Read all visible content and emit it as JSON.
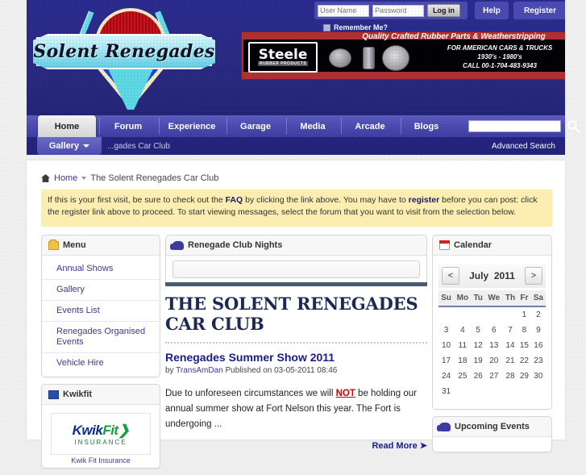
{
  "site": {
    "logo_text": "Solent Renegades"
  },
  "login": {
    "username_placeholder": "User Name",
    "password_placeholder": "Password",
    "login_label": "Log in",
    "remember_label": "Remember Me?",
    "help_label": "Help",
    "register_label": "Register"
  },
  "ad": {
    "headline": "Quality Crafted Rubber Parts & Weatherstripping",
    "brand": "Steele",
    "brand_sub": "RUBBER PRODUCTS",
    "line1": "FOR AMERICAN CARS & TRUCKS",
    "line2": "1930's - 1980's",
    "line3": "CALL 00-1-704-483-9343"
  },
  "nav": {
    "items": [
      {
        "label": "Home",
        "active": true
      },
      {
        "label": "Forum",
        "active": false
      },
      {
        "label": "Experience",
        "active": false
      },
      {
        "label": "Garage",
        "active": false
      },
      {
        "label": "Media",
        "active": false
      },
      {
        "label": "Arcade",
        "active": false
      },
      {
        "label": "Blogs",
        "active": false
      }
    ],
    "gallery_label": "Gallery",
    "subnav_text": "...gades Car Club",
    "advanced_search": "Advanced Search",
    "search_value": ""
  },
  "breadcrumb": {
    "home": "Home",
    "current": "The Solent Renegades Car Club"
  },
  "notice": {
    "part1": "If this is your first visit, be sure to check out the ",
    "faq": "FAQ",
    "part2": " by clicking the link above. You may have to ",
    "register": "register",
    "part3": " before you can post: click the register link above to proceed. To start viewing messages, select the forum that you want to visit from the selection below."
  },
  "sidebar": {
    "menu_title": "Menu",
    "menu_items": [
      {
        "label": "Annual Shows"
      },
      {
        "label": "Gallery"
      },
      {
        "label": "Events List"
      },
      {
        "label": "Renegades Organised Events"
      },
      {
        "label": "Vehicle Hire"
      }
    ],
    "kwikfit_title": "Kwikfit",
    "kwikfit_logo_a": "Kwik",
    "kwikfit_logo_b": "Fit",
    "kwikfit_logo_sub": "INSURANCE",
    "kwikfit_caption": "Kwik Fit Insurance"
  },
  "main": {
    "club_nights_title": "Renegade Club Nights",
    "page_title": "THE SOLENT RENEGADES CAR CLUB",
    "article": {
      "title": "Renegades Summer Show 2011",
      "by_label": "by",
      "author": "TransAmDan",
      "published_label": "Published on",
      "published_date": "03-05-2011 08:46",
      "body_pre": "Due to unforeseen circumstances we will ",
      "body_emphasis": "NOT",
      "body_post": " be holding our annual summer show at Fort Nelson this year. The Fort is undergoing ...",
      "read_more": "Read More"
    }
  },
  "calendar": {
    "title": "Calendar",
    "prev_label": "<",
    "next_label": ">",
    "month": "July",
    "year": "2011",
    "weekdays": [
      "Su",
      "Mo",
      "Tu",
      "We",
      "Th",
      "Fr",
      "Sa"
    ],
    "weeks": [
      [
        "",
        "",
        "",
        "",
        "",
        "1",
        "2"
      ],
      [
        "3",
        "4",
        "5",
        "6",
        "7",
        "8",
        "9"
      ],
      [
        "10",
        "11",
        "12",
        "13",
        "14",
        "15",
        "16"
      ],
      [
        "17",
        "18",
        "19",
        "20",
        "21",
        "22",
        "23"
      ],
      [
        "24",
        "25",
        "26",
        "27",
        "28",
        "29",
        "30"
      ],
      [
        "31",
        "",
        "",
        "",
        "",
        "",
        ""
      ]
    ],
    "upcoming_title": "Upcoming Events"
  },
  "colors": {
    "header_blue": "#2a2a87",
    "nav_blue": "#4949ae",
    "subnav_blue": "#23237c",
    "link_blue": "#3b3b8f",
    "notice_yellow": "#fbeeb0",
    "accent_red": "#d40000"
  }
}
